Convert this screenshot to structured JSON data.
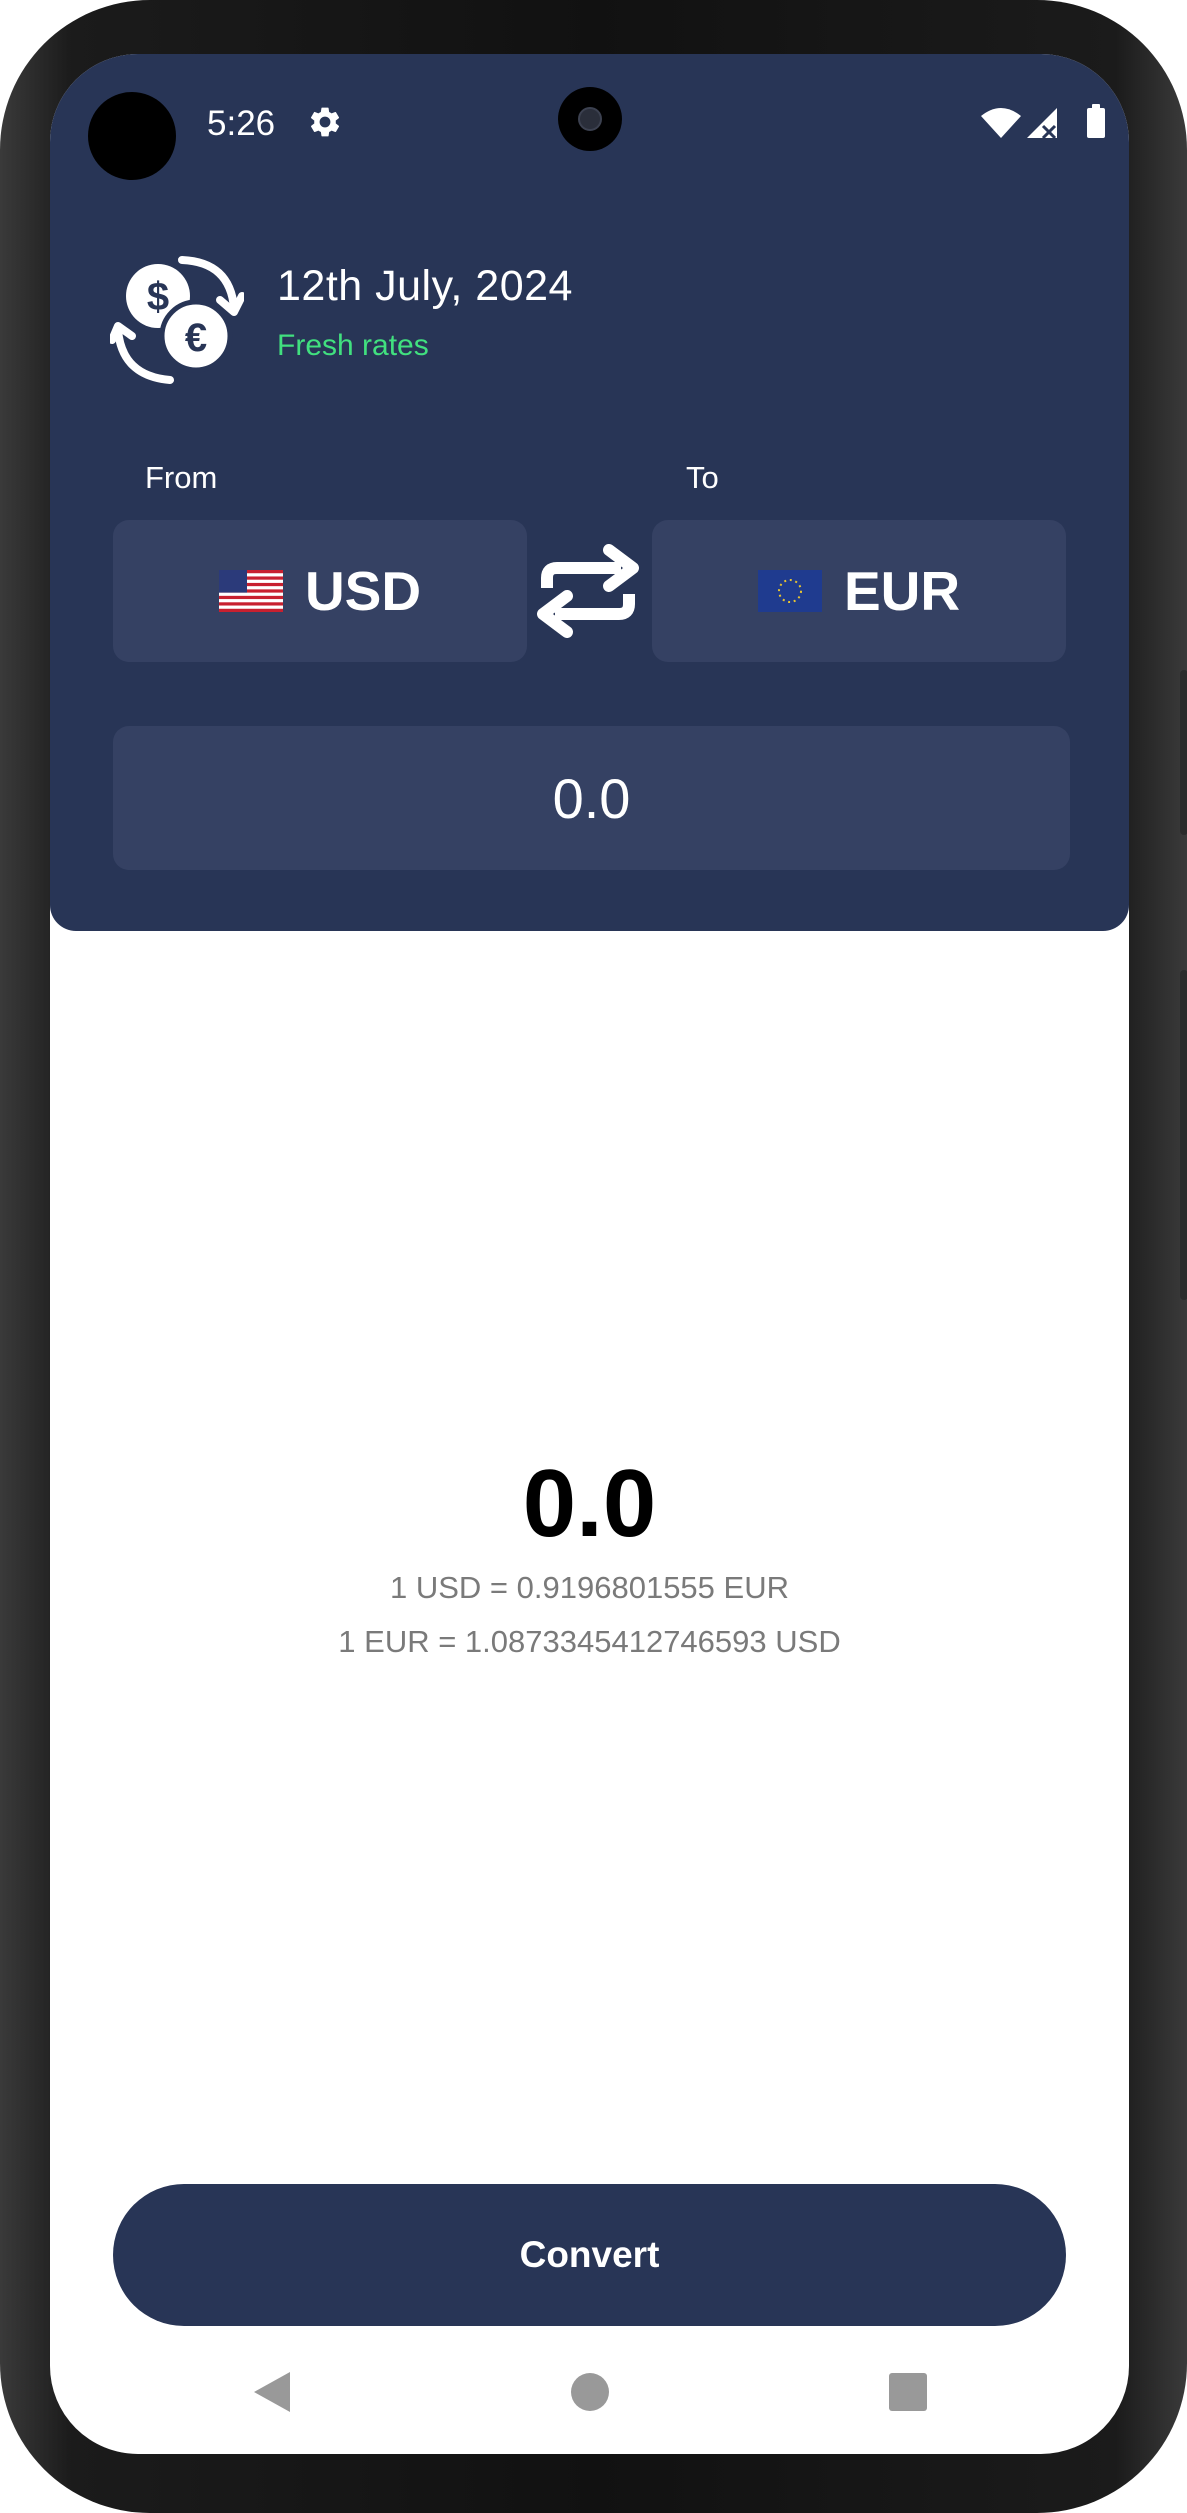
{
  "status_bar": {
    "time": "5:26"
  },
  "header": {
    "date": "12th July, 2024",
    "rates_status": "Fresh rates",
    "rates_status_color": "#41e07f"
  },
  "converter": {
    "from_label": "From",
    "to_label": "To",
    "from_currency": "USD",
    "to_currency": "EUR",
    "amount_value": "0.0"
  },
  "result": {
    "value": "0.0",
    "rate_forward": "1 USD = 0.9196801555 EUR",
    "rate_reverse": "1 EUR = 1.0873345412746593 USD"
  },
  "actions": {
    "convert_label": "Convert"
  },
  "colors": {
    "primary": "#283556",
    "card": "#354163",
    "accent_green": "#41e07f"
  }
}
